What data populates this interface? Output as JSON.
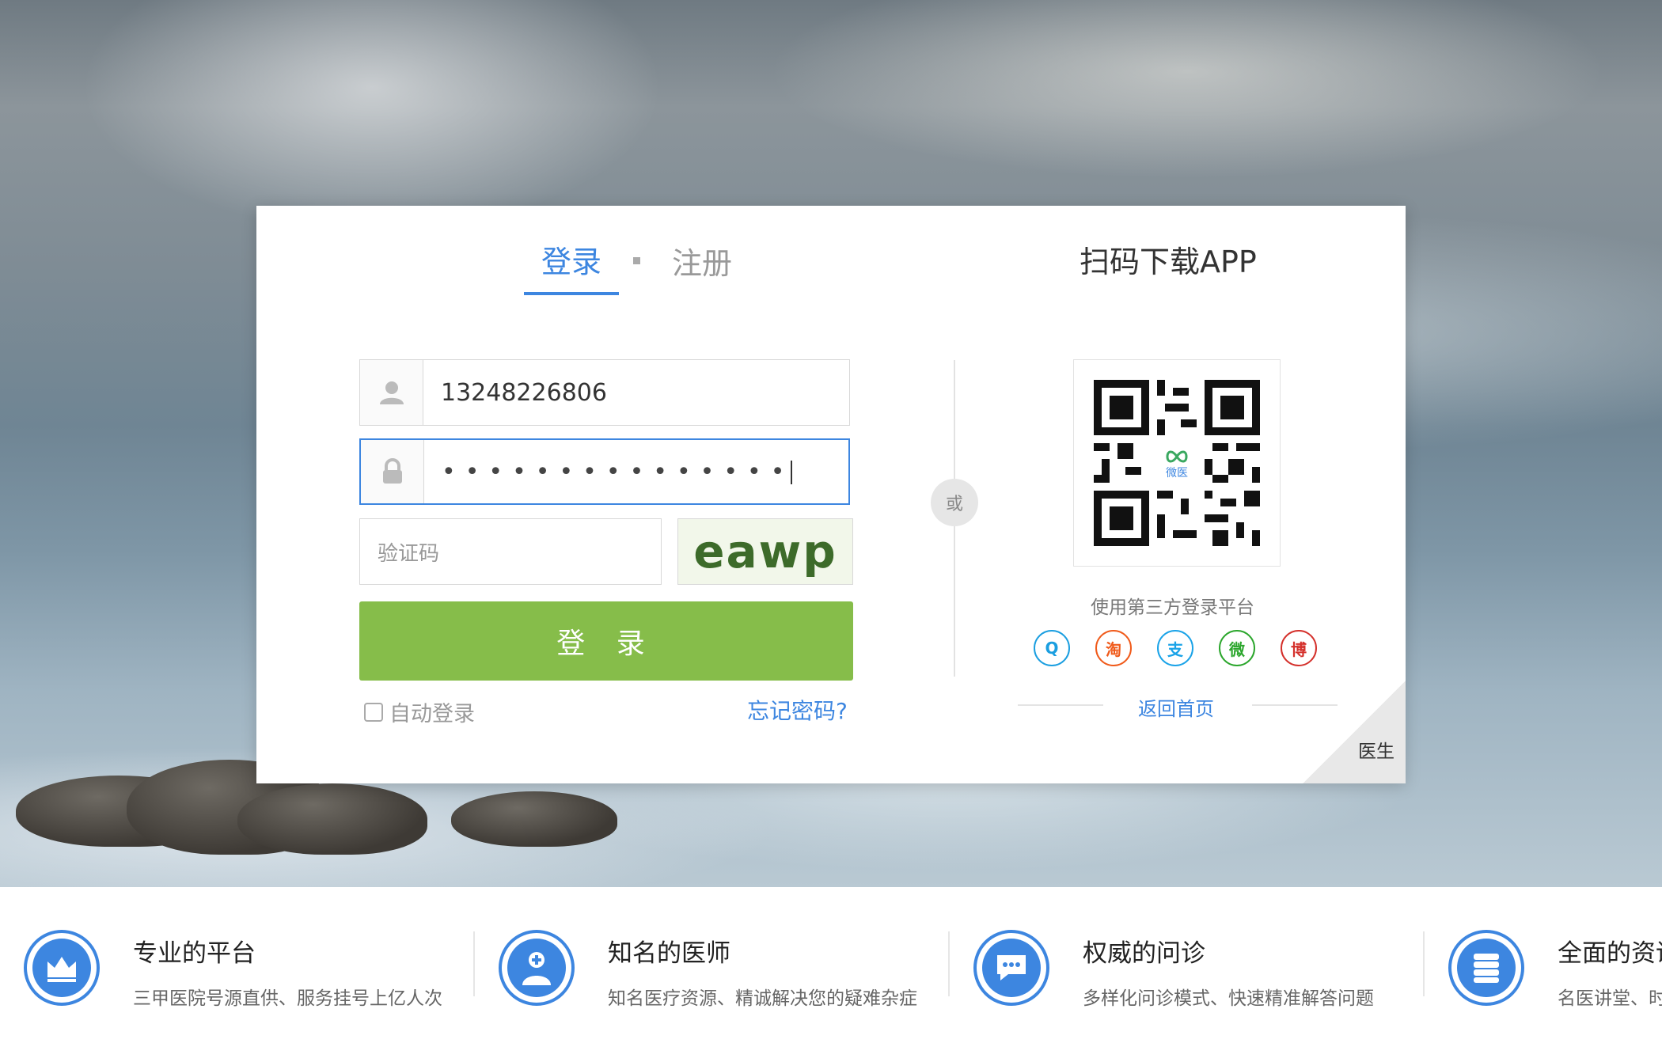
{
  "tabs": {
    "login": "登录",
    "register": "注册"
  },
  "form": {
    "phone_value": "13248226806",
    "password_mask": "•••••••••••••••",
    "captcha_placeholder": "验证码",
    "captcha_text": "eawp",
    "login_button": "登 录",
    "auto_login": "自动登录",
    "forgot": "忘记密码?"
  },
  "divider_or": "或",
  "qr": {
    "title": "扫码下载APP",
    "logo_text": "微医"
  },
  "third_party": {
    "label": "使用第三方登录平台",
    "icons": [
      {
        "name": "qq-icon",
        "glyph": "Q",
        "color": "#1a9ee0"
      },
      {
        "name": "taobao-icon",
        "glyph": "淘",
        "color": "#f05a1a"
      },
      {
        "name": "alipay-icon",
        "glyph": "支",
        "color": "#1aa3e8"
      },
      {
        "name": "wechat-icon",
        "glyph": "微",
        "color": "#2ba62c"
      },
      {
        "name": "weibo-icon",
        "glyph": "博",
        "color": "#d4302b"
      }
    ]
  },
  "home_link": "返回首页",
  "corner_label": "医生",
  "features": [
    {
      "title": "专业的平台",
      "desc": "三甲医院号源直供、服务挂号上亿人次",
      "icon": "crown-icon"
    },
    {
      "title": "知名的医师",
      "desc": "知名医疗资源、精诚解决您的疑难杂症",
      "icon": "doctor-icon"
    },
    {
      "title": "权威的问诊",
      "desc": "多样化问诊模式、快速精准解答问题",
      "icon": "chat-icon"
    },
    {
      "title": "全面的资讯",
      "desc": "名医讲堂、时",
      "icon": "list-icon"
    }
  ],
  "colors": {
    "accent": "#3d86e0",
    "login_button": "#86bd4a"
  }
}
